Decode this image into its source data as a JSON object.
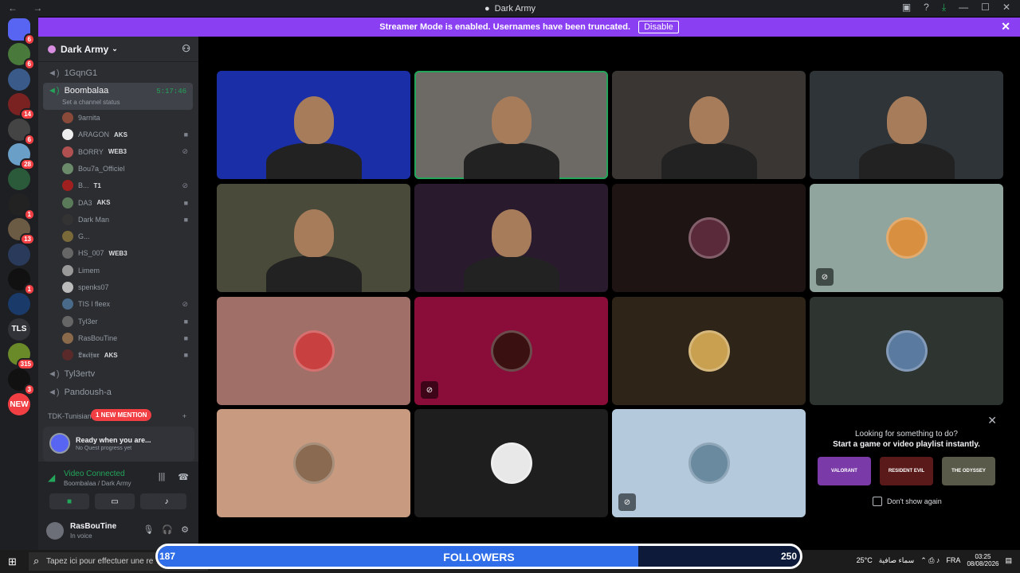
{
  "window": {
    "title": "Dark Army"
  },
  "banner": {
    "text": "Streamer Mode is enabled. Usernames have been truncated.",
    "button": "Disable"
  },
  "guilds": [
    {
      "label": "",
      "badge": "6",
      "color": "#5865f2"
    },
    {
      "label": "",
      "badge": "6",
      "color": "#4a7a3b"
    },
    {
      "label": "",
      "badge": "",
      "color": "#3a5a8a"
    },
    {
      "label": "",
      "badge": "14",
      "color": "#7a2222"
    },
    {
      "label": "",
      "badge": "6",
      "color": "#444"
    },
    {
      "label": "",
      "badge": "28",
      "color": "#6aa0c8"
    },
    {
      "label": "",
      "badge": "",
      "color": "#2a5a3a"
    },
    {
      "label": "",
      "badge": "1",
      "color": "#222"
    },
    {
      "label": "",
      "badge": "13",
      "color": "#6b5a44"
    },
    {
      "label": "",
      "badge": "",
      "color": "#2a3a5a"
    },
    {
      "label": "",
      "badge": "1",
      "color": "#111"
    },
    {
      "label": "",
      "badge": "",
      "color": "#1a3a6a"
    },
    {
      "label": "TLS",
      "badge": "",
      "color": "#313338"
    },
    {
      "label": "",
      "badge": "315",
      "color": "#6a8a2a"
    },
    {
      "label": "",
      "badge": "3",
      "color": "#111"
    },
    {
      "label": "NEW",
      "badge": "",
      "color": "#f23f43"
    }
  ],
  "server": {
    "name": "Dark Army"
  },
  "channels": {
    "top": "1GqnG1",
    "active": {
      "name": "Boombalaa",
      "timer": "5:17:46",
      "status": "Set a channel status"
    },
    "after": [
      "Tyl3ertv",
      "Pandoush-a"
    ],
    "category": "TDK-Tunisian",
    "new_mention": "1 NEW MENTION"
  },
  "members": [
    {
      "name": "9arnita",
      "tag": "",
      "color": "#8a4a3a",
      "icon": ""
    },
    {
      "name": "ARAGON",
      "tag": "AKS",
      "color": "#eeeeee",
      "icon": "camera-icon"
    },
    {
      "name": "BORRY",
      "tag": "WEB3",
      "color": "#b05050",
      "icon": "mute-icon"
    },
    {
      "name": "Bou7a_Officiel",
      "tag": "",
      "color": "#6a8a6a",
      "icon": ""
    },
    {
      "name": "B...",
      "tag": "T1",
      "color": "#a02020",
      "icon": "mute-icon"
    },
    {
      "name": "DA3",
      "tag": "AKS",
      "color": "#5a7a5a",
      "icon": "camera-icon"
    },
    {
      "name": "Dark Man",
      "tag": "",
      "color": "#333",
      "icon": "camera-icon"
    },
    {
      "name": "G...",
      "tag": "",
      "color": "#7a6a3a",
      "icon": ""
    },
    {
      "name": "HS_007",
      "tag": "WEB3",
      "color": "#666",
      "icon": ""
    },
    {
      "name": "Limem",
      "tag": "",
      "color": "#999",
      "icon": ""
    },
    {
      "name": "spenks07",
      "tag": "",
      "color": "#bbb",
      "icon": ""
    },
    {
      "name": "TIS l fleex",
      "tag": "",
      "color": "#4a6a8a",
      "icon": "mute-icon"
    },
    {
      "name": "Tyl3er",
      "tag": "",
      "color": "#666",
      "icon": "camera-icon"
    },
    {
      "name": "RasBouTine",
      "tag": "",
      "color": "#8a6a4a",
      "icon": "camera-icon"
    },
    {
      "name": "𝕷𝖚𝖈𝖎𝖋𝖚𝖗",
      "tag": "AKS",
      "color": "#5a2a2a",
      "icon": "camera-icon"
    }
  ],
  "quest": {
    "title": "Ready when you are...",
    "sub": "No Quest progress yet"
  },
  "voice": {
    "status": "Video Connected",
    "location": "Boombalaa / Dark Army"
  },
  "user": {
    "name": "RasBouTine",
    "status": "In voice"
  },
  "tiles": [
    {
      "type": "video",
      "bg": "#1a2ea8",
      "muted": false,
      "speaking": false
    },
    {
      "type": "video",
      "bg": "#6d6a66",
      "muted": false,
      "speaking": true
    },
    {
      "type": "video",
      "bg": "#3a3634",
      "muted": false,
      "speaking": false
    },
    {
      "type": "video",
      "bg": "#2e3438",
      "muted": false,
      "speaking": false
    },
    {
      "type": "video",
      "bg": "#4a4a3a",
      "muted": false,
      "speaking": false
    },
    {
      "type": "video",
      "bg": "#2a1a2e",
      "muted": false,
      "speaking": false
    },
    {
      "type": "avatar",
      "bg": "#1e1414",
      "avatar": "#5a2a3a",
      "muted": false,
      "speaking": false
    },
    {
      "type": "avatar",
      "bg": "#8fa59e",
      "avatar": "#d89040",
      "muted": true,
      "speaking": false
    },
    {
      "type": "avatar",
      "bg": "#a07068",
      "avatar": "#c84040",
      "muted": false,
      "speaking": false
    },
    {
      "type": "avatar",
      "bg": "#8a0c38",
      "avatar": "#3a1010",
      "muted": true,
      "speaking": false
    },
    {
      "type": "avatar",
      "bg": "#2e2418",
      "avatar": "#c8a050",
      "muted": false,
      "speaking": false
    },
    {
      "type": "avatar",
      "bg": "#2e3430",
      "avatar": "#5a7aa0",
      "muted": false,
      "speaking": false
    },
    {
      "type": "avatar",
      "bg": "#c89a80",
      "avatar": "#8a6a50",
      "muted": false,
      "speaking": false
    },
    {
      "type": "avatar",
      "bg": "#1e1e1e",
      "avatar": "#e8e8e8",
      "muted": false,
      "speaking": false
    },
    {
      "type": "avatar",
      "bg": "#b4cadc",
      "avatar": "#6a8aa0",
      "muted": true,
      "speaking": false
    }
  ],
  "promo": {
    "line1": "Looking for something to do?",
    "line2": "Start a game or video playlist instantly.",
    "checkbox": "Don't show again",
    "games": [
      {
        "label": "VALORANT",
        "color": "#7a3aa8"
      },
      {
        "label": "RESIDENT EVIL",
        "color": "#5a1a1a"
      },
      {
        "label": "THE ODYSSEY",
        "color": "#5a5a4a"
      }
    ]
  },
  "taskbar": {
    "search": "Tapez ici pour effectuer une re",
    "weather": "سماء صافية",
    "temp": "25°C",
    "lang": "FRA",
    "time": "03:25",
    "date": "08/08/2026"
  },
  "followers": {
    "label": "FOLLOWERS",
    "current": "187",
    "goal": "250",
    "progress": 0.748
  }
}
